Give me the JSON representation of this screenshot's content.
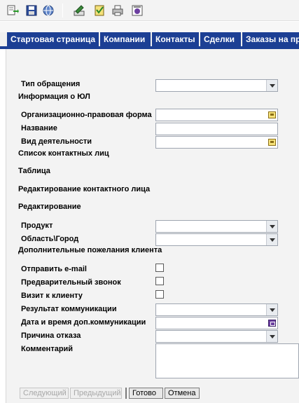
{
  "toolbar": {
    "icons": [
      "export-icon",
      "save-icon",
      "globe-icon",
      "edit-icon",
      "checklist-icon",
      "print-icon",
      "report-icon"
    ]
  },
  "tabs": [
    {
      "label": "Стартовая страница"
    },
    {
      "label": "Компании"
    },
    {
      "label": "Контакты"
    },
    {
      "label": "Сделки"
    },
    {
      "label": "Заказы на пр"
    }
  ],
  "form": {
    "request_type_label": "Тип обращения",
    "request_type_value": "",
    "legal_info_heading": "Информация о ЮЛ",
    "org_form_label": "Организационно-правовая форма",
    "org_form_value": "",
    "name_label": "Название",
    "name_value": "",
    "activity_label": "Вид деятельности",
    "activity_value": "",
    "contacts_heading": "Список контактных лиц",
    "table_heading": "Таблица",
    "edit_contact_heading": "Редактирование контактного лица",
    "edit_heading": "Редактирование",
    "product_label": "Продукт",
    "product_value": "",
    "region_label": "Область\\Город",
    "region_value": "",
    "wishes_heading": "Дополнительные пожелания клиента",
    "send_email_label": "Отправить e-mail",
    "pre_call_label": "Предварительный звонок",
    "visit_label": "Визит к клиенту",
    "result_label": "Результат коммуникации",
    "result_value": "",
    "datetime_label": "Дата и время доп.коммуникации",
    "datetime_value": "",
    "refusal_label": "Причина отказа",
    "refusal_value": "",
    "comment_label": "Комментарий",
    "comment_value": ""
  },
  "buttons": {
    "next": "Следующий",
    "prev": "Предыдущий",
    "done": "Готово",
    "cancel": "Отмена"
  }
}
